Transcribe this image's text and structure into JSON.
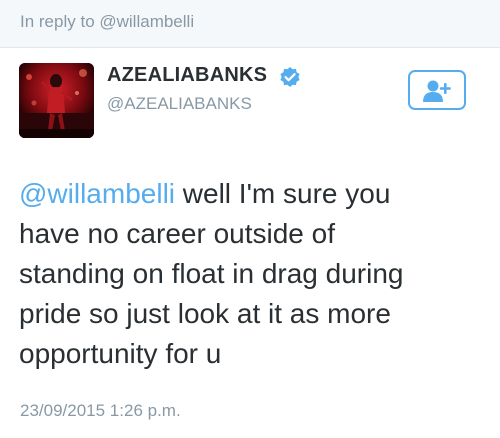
{
  "reply_context": {
    "text": "In reply to @willambelli"
  },
  "author": {
    "display_name": "AZEALIABANKS",
    "handle": "@AZEALIABANKS",
    "verified": true,
    "avatar_icon": "profile-photo"
  },
  "follow_button": {
    "icon": "add-user-icon"
  },
  "tweet": {
    "mention": "@willambelli",
    "line1_rest": " well I'm sure you",
    "line2": "have no career outside of",
    "line3": "standing on float in drag during",
    "line4": "pride so just look at it as more",
    "line5": "opportunity for u"
  },
  "timestamp": "23/09/2015 1:26 p.m.",
  "colors": {
    "accent": "#55acee",
    "text": "#292f33",
    "muted": "#8899a6",
    "reply_bg": "#f5f8fa"
  }
}
